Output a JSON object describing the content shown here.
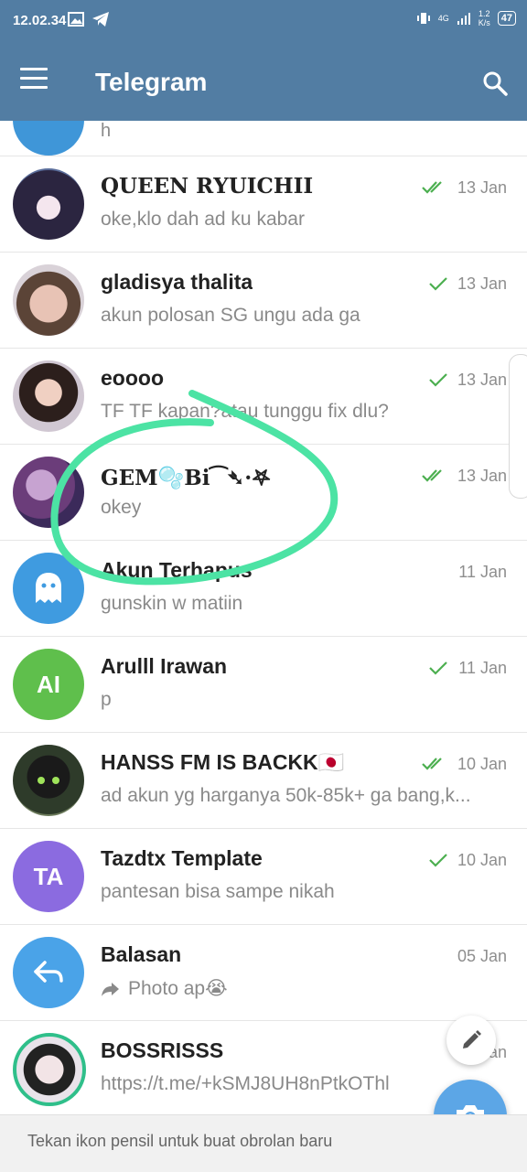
{
  "status_bar": {
    "time": "12.02.34",
    "network": "4G",
    "speed_value": "1.2",
    "speed_unit": "K/s",
    "battery": "47"
  },
  "header": {
    "title": "Telegram"
  },
  "partial_row": {
    "message": "h"
  },
  "chats": [
    {
      "name": "𝐐𝐔𝐄𝐄𝐍 𝐑𝐘𝐔𝐈𝐂𝐇𝐈𝐈",
      "message": "oke,klo dah ad ku kabar",
      "date": "13 Jan",
      "status": "read"
    },
    {
      "name": "gladisya thalita",
      "message": "akun polosan SG ungu ada ga",
      "date": "13 Jan",
      "status": "sent"
    },
    {
      "name": "eoooo",
      "message": "TF TF kapan?atau tunggu fix dlu?",
      "date": "13 Jan",
      "status": "sent"
    },
    {
      "name": "𝐆𝐄𝐌🫧𝐁𝐢⁀➴·𖤐",
      "message": "okey",
      "date": "13 Jan",
      "status": "read"
    },
    {
      "name": "Akun Terhapus",
      "message": "gunskin w matiin",
      "date": "11 Jan",
      "status": "none"
    },
    {
      "name": "Arulll Irawan",
      "message": "p",
      "date": "11 Jan",
      "status": "sent",
      "initials": "AI"
    },
    {
      "name": "HANSS FM IS BACKK🇯🇵",
      "message": "ad akun yg harganya 50k-85k+ ga bang,k...",
      "date": "10 Jan",
      "status": "read"
    },
    {
      "name": "Tazdtx Template",
      "message": "pantesan bisa sampe nikah",
      "date": "10 Jan",
      "status": "sent",
      "initials": "TA"
    },
    {
      "name": "Balasan",
      "message": "Photo ap😭",
      "date": "05 Jan",
      "status": "none"
    },
    {
      "name": "BOSSRISSS",
      "message": "https://t.me/+kSMJ8UH8nPtkOThl",
      "date": "Jan",
      "status": "none"
    }
  ],
  "bottom": {
    "hint": "Tekan ikon pensil untuk buat obrolan baru"
  },
  "colors": {
    "header": "#527da3",
    "check": "#4caf50",
    "fab": "#5ca6e6",
    "annotation": "#4ce3a4"
  }
}
